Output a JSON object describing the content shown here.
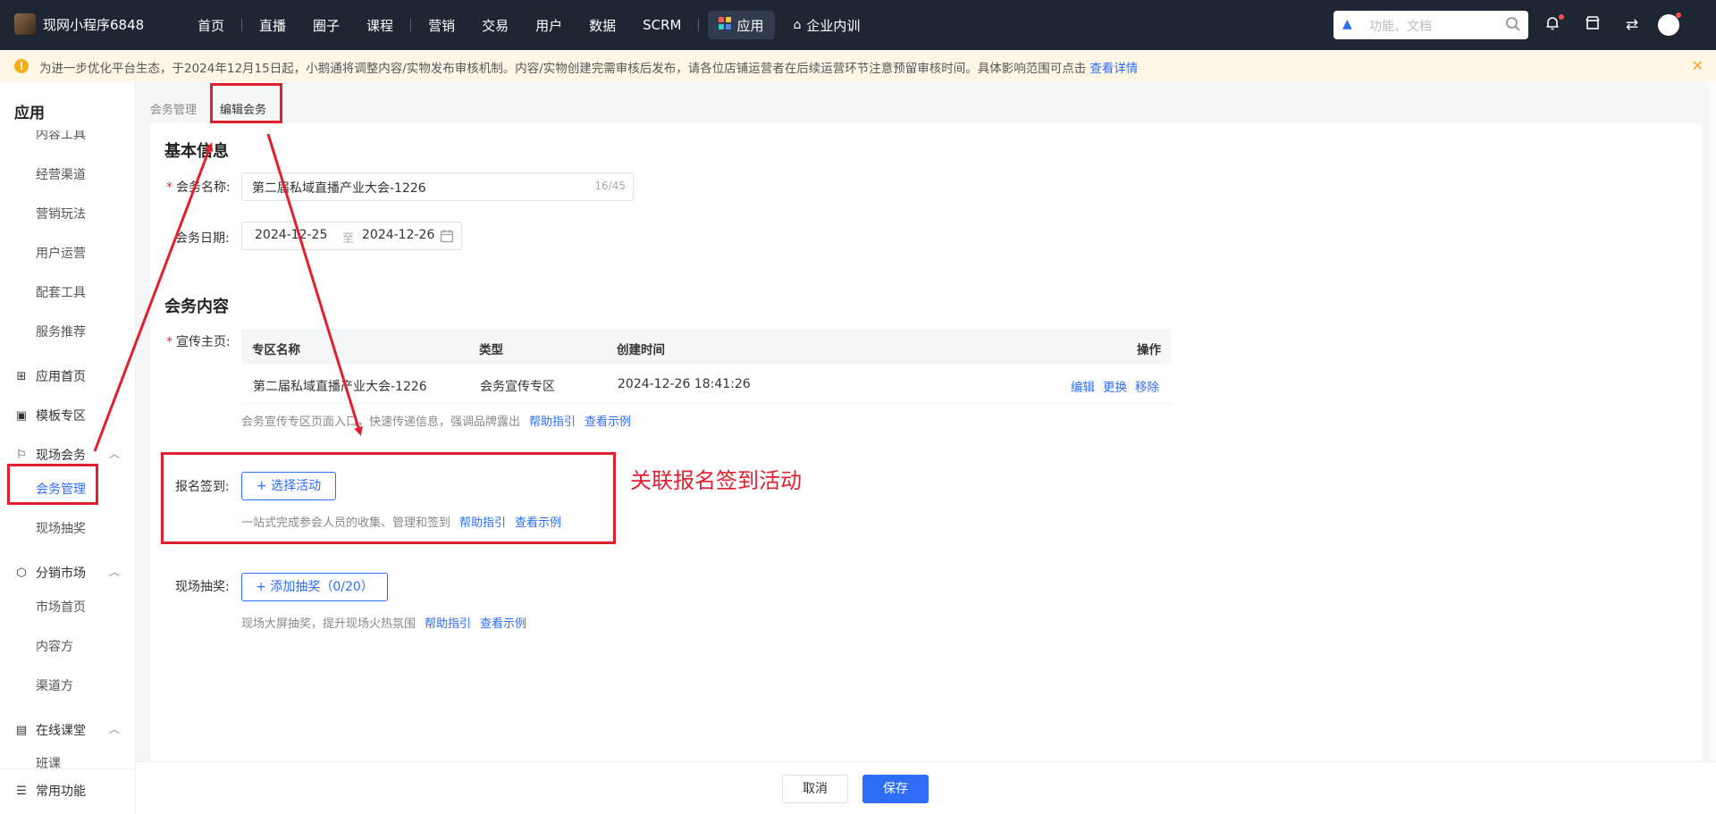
{
  "header": {
    "app_name": "现网小程序6848",
    "nav": [
      "首页",
      "直播",
      "圈子",
      "课程",
      "营销",
      "交易",
      "用户",
      "数据",
      "SCRM",
      "应用",
      "企业内训"
    ],
    "search_placeholder": "功能、文档"
  },
  "notice": {
    "text": "为进一步优化平台生态，于2024年12月15日起，小鹅通将调整内容/实物发布审核机制。内容/实物创建完需审核后发布，请各位店铺运营者在后续运营环节注意预留审核时间。具体影响范围可点击",
    "link": "查看详情"
  },
  "sidebar": {
    "title": "应用",
    "items_top": [
      "内容工具",
      "经营渠道",
      "营销玩法",
      "用户运营",
      "配套工具",
      "服务推荐"
    ],
    "groups": {
      "app_home": "应用首页",
      "template_zone": "模板专区",
      "onsite_meeting": "现场会务",
      "meeting_manage": "会务管理",
      "onsite_lottery": "现场抽奖",
      "distribution": "分销市场",
      "market_home": "市场首页",
      "content_side": "内容方",
      "channel_side": "渠道方",
      "online_class": "在线课堂",
      "class": "班课",
      "common": "常用功能"
    }
  },
  "breadcrumb": {
    "parent": "会务管理",
    "current": "编辑会务"
  },
  "basic": {
    "title": "基本信息",
    "name_label": "会务名称:",
    "name_value": "第二届私域直播产业大会-1226",
    "name_count": "16/45",
    "date_label": "会务日期:",
    "date_start": "2024-12-25",
    "date_sep": "至",
    "date_end": "2024-12-26"
  },
  "content": {
    "title": "会务内容",
    "promo_label": "宣传主页:",
    "columns": [
      "专区名称",
      "类型",
      "创建时间",
      "操作"
    ],
    "row": {
      "name": "第二届私域直播产业大会-1226",
      "type": "会务宣传专区",
      "created": "2024-12-26 18:41:26",
      "actions": [
        "编辑",
        "更换",
        "移除"
      ]
    },
    "promo_hint": "会务宣传专区页面入口，快速传递信息，强调品牌露出",
    "help": "帮助指引",
    "example": "查看示例",
    "signup_label": "报名签到:",
    "signup_btn": "+ 选择活动",
    "signup_hint": "一站式完成参会人员的收集、管理和签到",
    "lottery_label": "现场抽奖:",
    "lottery_btn": "+ 添加抽奖（0/20）",
    "lottery_hint": "现场大屏抽奖，提升现场火热氛围"
  },
  "annotation": "关联报名签到活动",
  "footer": {
    "cancel": "取消",
    "save": "保存"
  },
  "colors": {
    "accent": "#2f6df6",
    "annotation_red": "#e0202f",
    "topbar": "#1f2633"
  }
}
